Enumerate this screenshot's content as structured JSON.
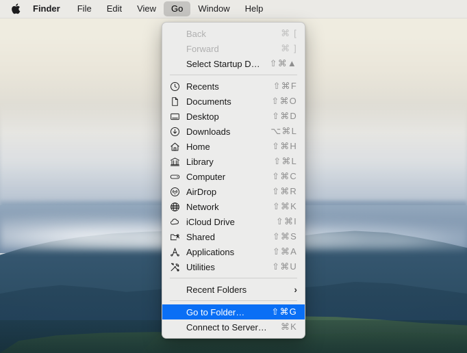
{
  "menubar": {
    "apple_icon": "apple-logo-icon",
    "items": [
      {
        "label": "Finder",
        "bold": true,
        "active": false
      },
      {
        "label": "File",
        "bold": false,
        "active": false
      },
      {
        "label": "Edit",
        "bold": false,
        "active": false
      },
      {
        "label": "View",
        "bold": false,
        "active": false
      },
      {
        "label": "Go",
        "bold": false,
        "active": true
      },
      {
        "label": "Window",
        "bold": false,
        "active": false
      },
      {
        "label": "Help",
        "bold": false,
        "active": false
      }
    ]
  },
  "accent_color": "#0a6ff5",
  "menu_background": "#ececeb",
  "go_menu": {
    "name": "Go",
    "items": [
      {
        "type": "item",
        "label": "Back",
        "shortcut": "⌘ [",
        "icon": null,
        "disabled": true,
        "selected": false
      },
      {
        "type": "item",
        "label": "Forward",
        "shortcut": "⌘ ]",
        "icon": null,
        "disabled": true,
        "selected": false
      },
      {
        "type": "item",
        "label": "Select Startup Disk",
        "shortcut": "⇧⌘▲",
        "icon": null,
        "disabled": false,
        "selected": false
      },
      {
        "type": "separator"
      },
      {
        "type": "item",
        "label": "Recents",
        "shortcut": "⇧⌘F",
        "icon": "clock-icon",
        "disabled": false,
        "selected": false
      },
      {
        "type": "item",
        "label": "Documents",
        "shortcut": "⇧⌘O",
        "icon": "document-icon",
        "disabled": false,
        "selected": false
      },
      {
        "type": "item",
        "label": "Desktop",
        "shortcut": "⇧⌘D",
        "icon": "desktop-icon",
        "disabled": false,
        "selected": false
      },
      {
        "type": "item",
        "label": "Downloads",
        "shortcut": "⌥⌘L",
        "icon": "download-icon",
        "disabled": false,
        "selected": false
      },
      {
        "type": "item",
        "label": "Home",
        "shortcut": "⇧⌘H",
        "icon": "home-icon",
        "disabled": false,
        "selected": false
      },
      {
        "type": "item",
        "label": "Library",
        "shortcut": "⇧⌘L",
        "icon": "library-icon",
        "disabled": false,
        "selected": false
      },
      {
        "type": "item",
        "label": "Computer",
        "shortcut": "⇧⌘C",
        "icon": "computer-icon",
        "disabled": false,
        "selected": false
      },
      {
        "type": "item",
        "label": "AirDrop",
        "shortcut": "⇧⌘R",
        "icon": "airdrop-icon",
        "disabled": false,
        "selected": false
      },
      {
        "type": "item",
        "label": "Network",
        "shortcut": "⇧⌘K",
        "icon": "network-icon",
        "disabled": false,
        "selected": false
      },
      {
        "type": "item",
        "label": "iCloud Drive",
        "shortcut": "⇧⌘I",
        "icon": "cloud-icon",
        "disabled": false,
        "selected": false
      },
      {
        "type": "item",
        "label": "Shared",
        "shortcut": "⇧⌘S",
        "icon": "shared-icon",
        "disabled": false,
        "selected": false
      },
      {
        "type": "item",
        "label": "Applications",
        "shortcut": "⇧⌘A",
        "icon": "applications-icon",
        "disabled": false,
        "selected": false
      },
      {
        "type": "item",
        "label": "Utilities",
        "shortcut": "⇧⌘U",
        "icon": "utilities-icon",
        "disabled": false,
        "selected": false
      },
      {
        "type": "separator"
      },
      {
        "type": "item",
        "label": "Recent Folders",
        "shortcut": null,
        "icon": null,
        "disabled": false,
        "selected": false,
        "submenu": true
      },
      {
        "type": "separator"
      },
      {
        "type": "item",
        "label": "Go to Folder…",
        "shortcut": "⇧⌘G",
        "icon": null,
        "disabled": false,
        "selected": true
      },
      {
        "type": "item",
        "label": "Connect to Server…",
        "shortcut": "⌘K",
        "icon": null,
        "disabled": false,
        "selected": false
      }
    ]
  }
}
